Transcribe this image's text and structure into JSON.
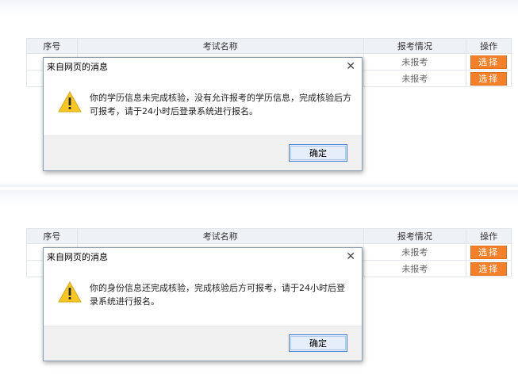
{
  "panels": [
    {
      "table": {
        "headers": [
          "序号",
          "考试名称",
          "报考情况",
          "操作"
        ],
        "rows": [
          {
            "status": "未报考",
            "action": "选择"
          },
          {
            "status": "未报考",
            "action": "选择"
          }
        ]
      },
      "dialog": {
        "title": "来自网页的消息",
        "message": "你的学历信息未完成核验，没有允许报考的学历信息，完成核验后方可报考，请于24小时后登录系统进行报名。",
        "ok_label": "确定"
      }
    },
    {
      "table": {
        "headers": [
          "序号",
          "考试名称",
          "报考情况",
          "操作"
        ],
        "rows": [
          {
            "status": "未报考",
            "action": "选择"
          },
          {
            "status": "未报考",
            "action": "选择"
          }
        ]
      },
      "dialog": {
        "title": "来自网页的消息",
        "message": "你的身份信息还完成核验，完成核验后方可报考，请于24小时后登录系统进行报名。",
        "ok_label": "确定"
      }
    }
  ],
  "icons": {
    "close": "close-icon",
    "warning": "warning-icon"
  },
  "colors": {
    "select_button": "#f5802a",
    "ok_border": "#3f7fd1"
  }
}
